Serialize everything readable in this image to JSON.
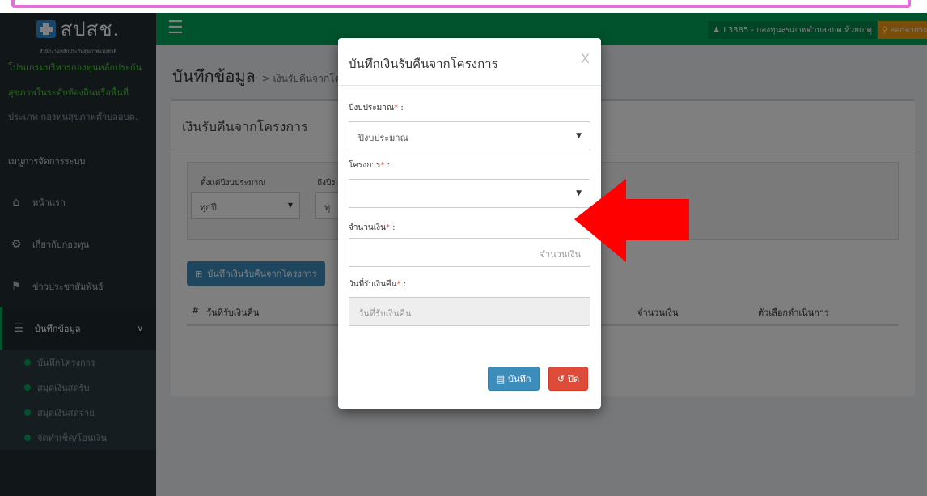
{
  "sidebar": {
    "logo_text": "สปสช.",
    "logo_sub": "สำนักงานหลักประกันสุขภาพแห่งชาติ",
    "program_line1": "โปรแกรมบริหารกองทุนหลักประกัน",
    "program_line2": "สุขภาพในระดับท้องถิ่นหรือพื้นที่",
    "program_type": "ประเภท กองทุนสุขภาพตำบลอบต.",
    "menu_header": "เมนูการจัดการระบบ",
    "items": [
      {
        "label": "หน้าแรก",
        "icon": "home-icon"
      },
      {
        "label": "เกี่ยวกับกองทุน",
        "icon": "cogs-icon"
      },
      {
        "label": "ข่าวประชาสัมพันธ์",
        "icon": "bullhorn-icon"
      },
      {
        "label": "บันทึกข้อมูล",
        "icon": "database-icon"
      }
    ],
    "submenu": [
      "บันทึกโครงการ",
      "สมุดเงินสดรับ",
      "สมุดเงินสดจ่าย",
      "จัดทำเช็ค/โอนเงิน"
    ]
  },
  "topbar": {
    "user": "L3385 - กองทุนสุขภาพตำบลอบต.ห้วยเกตุ",
    "logout": "ออกจากระบบ"
  },
  "content": {
    "page_title": "บันทึกข้อมูล",
    "breadcrumb": "> เงินรับคืนจากโครง",
    "box_title": "เงินรับคืนจากโครงการ",
    "filter_from_label": "ตั้งแต่ปีงบประมาณ",
    "filter_from_value": "ทุกปี",
    "filter_to_label": "ถึงปีง",
    "filter_to_value": "ทุ",
    "add_button": "บันทึกเงินรับคืนจากโครงการ",
    "table_headers": [
      "#",
      "วันที่รับเงินคืน",
      "จำนวนเงิน",
      "ตัวเลือกดำเนินการ"
    ]
  },
  "modal": {
    "title": "บันทึกเงินรับคืนจากโครงการ",
    "close_x": "X",
    "req_mark": "*",
    "fields": {
      "fiscal_year_label": "ปีงบประมาณ",
      "fiscal_year_value": "ปีงบประมาณ",
      "project_label": "โครงการ",
      "project_value": "",
      "amount_label": "จำนวนเงิน",
      "amount_placeholder": "จำนวนเงิน",
      "date_label": "วันที่รับเงินคืน",
      "date_placeholder": "วันที่รับเงินคืน"
    },
    "save_button": "บันทึก",
    "close_button": "ปิด"
  },
  "colors": {
    "sidebar_bg": "#222d32",
    "header_green": "#00a65a",
    "save_blue": "#3c8dbc",
    "close_red": "#dd4b39",
    "arrow_red": "#ff0000",
    "annotation_pink": "#e86ddb"
  }
}
